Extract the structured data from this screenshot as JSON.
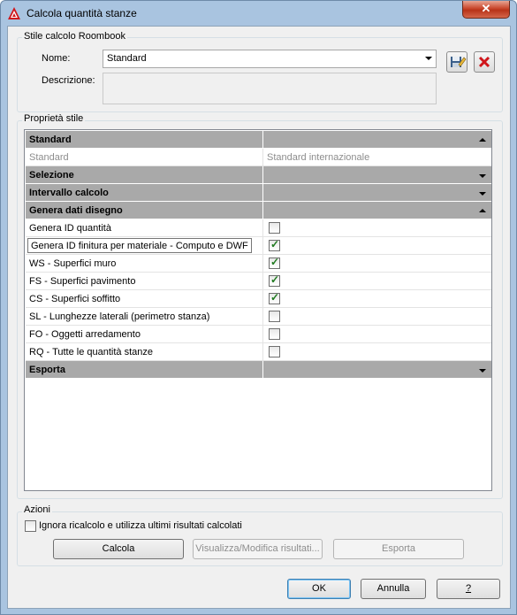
{
  "window": {
    "title": "Calcola quantità stanze",
    "close_label": "✕"
  },
  "style_group": {
    "label": "Stile calcolo Roombook",
    "name_label": "Nome:",
    "name_value": "Standard",
    "description_label": "Descrizione:",
    "description_value": ""
  },
  "properties": {
    "label": "Proprietà stile",
    "rows": [
      {
        "kind": "category",
        "name": "Standard",
        "expander": "up"
      },
      {
        "kind": "dim",
        "name": "Standard",
        "value": "Standard internazionale"
      },
      {
        "kind": "category",
        "name": "Selezione",
        "expander": "down"
      },
      {
        "kind": "category",
        "name": "Intervallo calcolo",
        "expander": "down"
      },
      {
        "kind": "category",
        "name": "Genera dati disegno",
        "expander": "up"
      },
      {
        "kind": "check",
        "name": "Genera ID quantità",
        "checked": false
      },
      {
        "kind": "check",
        "name": "Genera ID finitura per materiale - Computo e DWF",
        "checked": true,
        "tooltip": true
      },
      {
        "kind": "check",
        "name": "WS - Superfici muro",
        "checked": true
      },
      {
        "kind": "check",
        "name": "FS - Superfici pavimento",
        "checked": true
      },
      {
        "kind": "check",
        "name": "CS - Superfici soffitto",
        "checked": true
      },
      {
        "kind": "check",
        "name": "SL - Lunghezze laterali (perimetro stanza)",
        "checked": false
      },
      {
        "kind": "check",
        "name": "FO - Oggetti arredamento",
        "checked": false
      },
      {
        "kind": "check",
        "name": "RQ - Tutte le quantità stanze",
        "checked": false
      },
      {
        "kind": "category",
        "name": "Esporta",
        "expander": "down"
      }
    ]
  },
  "actions": {
    "label": "Azioni",
    "ignore_label": "Ignora ricalcolo e utilizza ultimi risultati calcolati",
    "ignore_checked": false,
    "calc_label": "Calcola",
    "view_label": "Visualizza/Modifica risultati...",
    "export_label": "Esporta"
  },
  "footer": {
    "ok_label": "OK",
    "cancel_label": "Annulla",
    "help_label": "?"
  },
  "colors": {
    "category_bg": "#a9a9a9",
    "check_green": "#1f7a1f",
    "close_red": "#c9462c"
  }
}
